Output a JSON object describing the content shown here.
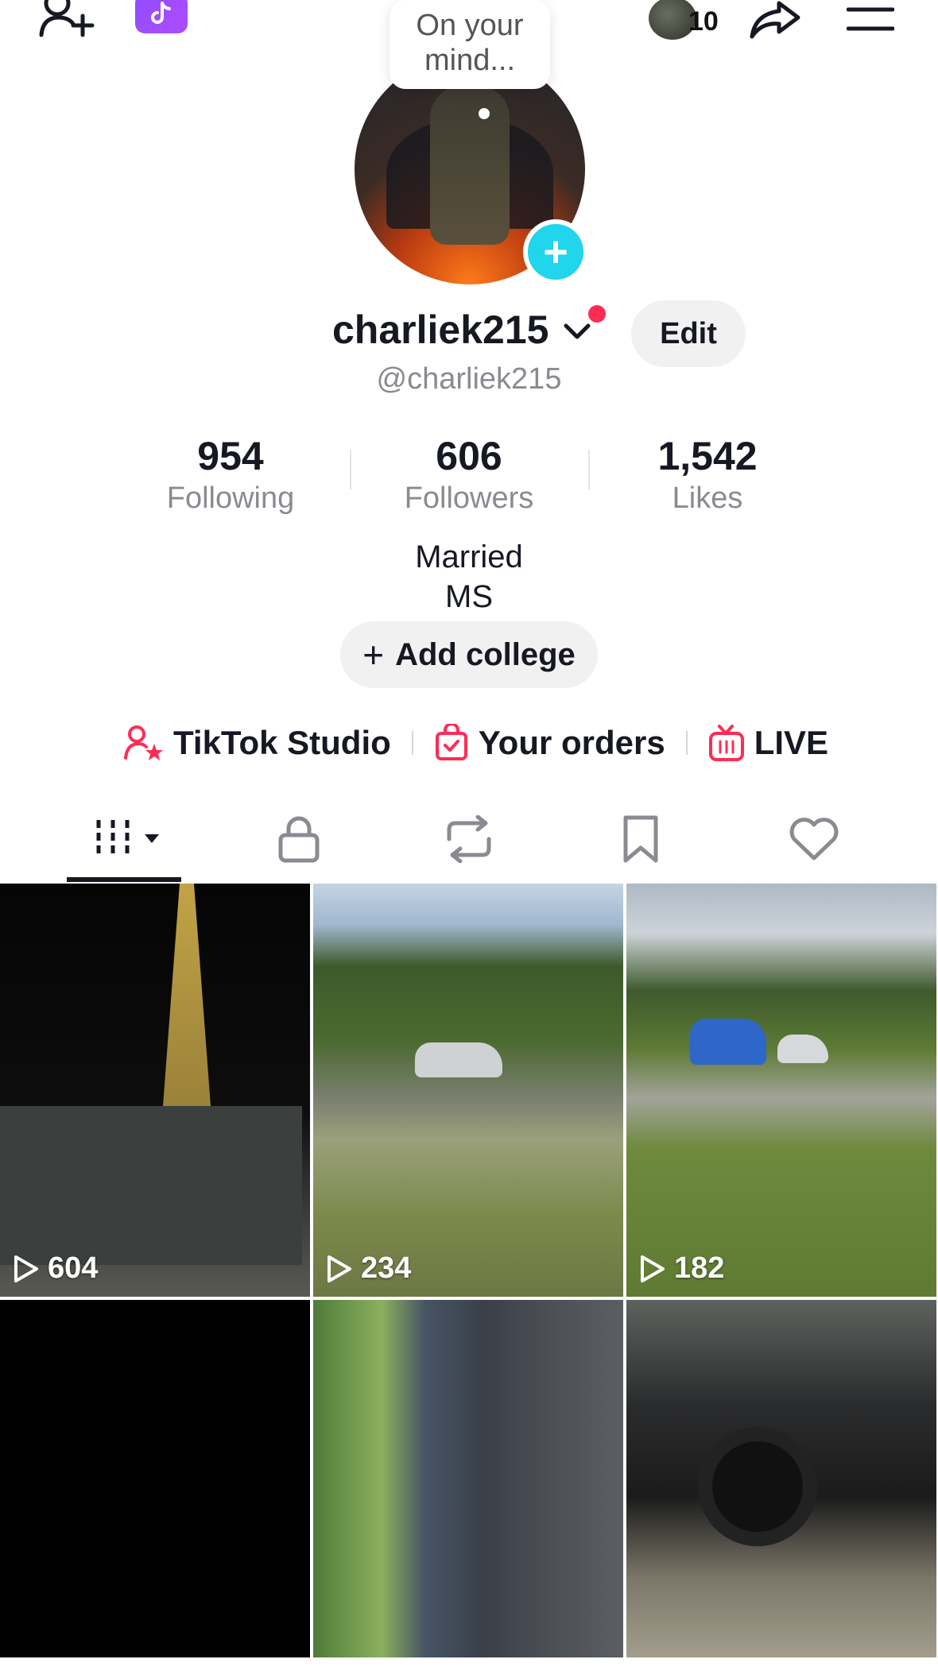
{
  "top_bar": {
    "friends_count": "10"
  },
  "bubble": {
    "text_line1": "On your",
    "text_line2": "mind..."
  },
  "profile": {
    "username": "charliek215",
    "edit_label": "Edit",
    "handle": "@charliek215"
  },
  "stats": {
    "following": {
      "value": "954",
      "label": "Following"
    },
    "followers": {
      "value": "606",
      "label": "Followers"
    },
    "likes": {
      "value": "1,542",
      "label": "Likes"
    }
  },
  "bio": {
    "line1": "Married",
    "line2": "MS"
  },
  "add_college": {
    "plus": "+",
    "label": "Add college"
  },
  "links": {
    "studio": "TikTok Studio",
    "orders": "Your orders",
    "live": "LIVE"
  },
  "tabs": [
    "videos",
    "private",
    "reposts",
    "favorites",
    "liked"
  ],
  "videos": [
    {
      "views": "604"
    },
    {
      "views": "234"
    },
    {
      "views": "182"
    },
    {
      "views": ""
    },
    {
      "views": ""
    },
    {
      "views": ""
    }
  ],
  "colors": {
    "accent_red": "#fe2c55",
    "accent_cyan": "#20d5ec",
    "text_primary": "#161823",
    "text_secondary": "#8a8b91"
  }
}
